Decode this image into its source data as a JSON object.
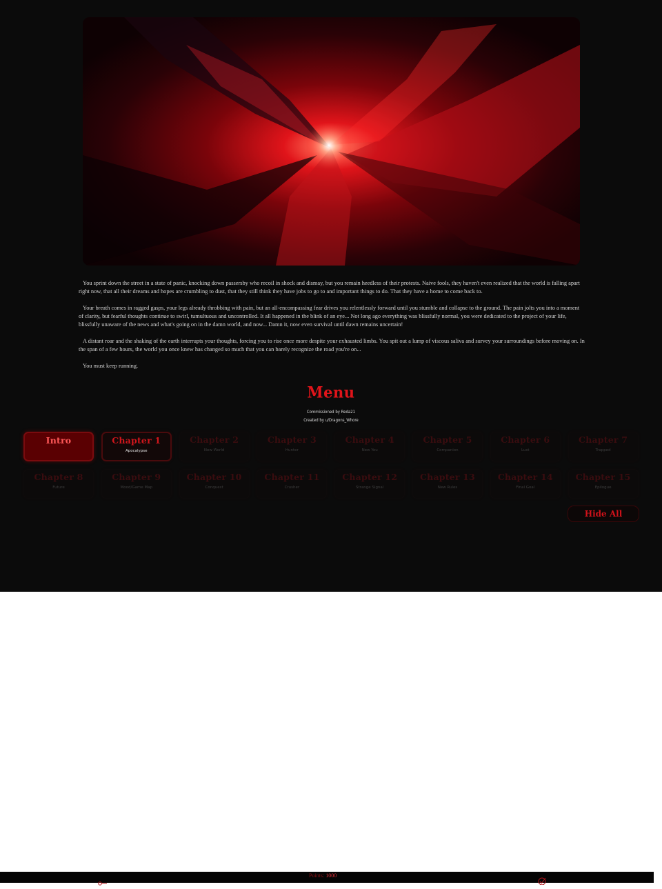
{
  "story": {
    "paragraphs": [
      "You sprint down the street in a state of panic, knocking down passersby who recoil in shock and dismay, but you remain heedless of their protests. Naive fools, they haven't even realized that the world is falling apart right now, that all their dreams and hopes are crumbling to dust, that they still think they have jobs to go to and important things to do. That they have a home to come back to.",
      "Your breath comes in ragged gasps, your legs already throbbing with pain, but an all-encompassing fear drives you relentlessly forward until you stumble and collapse to the ground. The pain jolts you into a moment of clarity, but fearful thoughts continue to swirl, tumultuous and uncontrolled. It all happened in the blink of an eye... Not long ago everything was blissfully normal, you were dedicated to the project of your life, blissfully unaware of the news and what's going on in the damn world, and now... Damn it, now even survival until dawn remains uncertain!",
      "A distant roar and the shaking of the earth interrupts your thoughts, forcing you to rise once more despite your exhausted limbs. You spit out a lump of viscous saliva and survey your surroundings before moving on. In the span of a few hours, the world you once knew has changed so much that you can barely recognize the road you're on...",
      "You must keep running."
    ]
  },
  "menu": {
    "title": "Menu",
    "commissioned": "Commissioned by Reda21",
    "created": "Created by u/Dragons_Whore",
    "hide_all": "Hide All"
  },
  "chapters": [
    {
      "title": "Intro",
      "subtitle": ""
    },
    {
      "title": "Chapter 1",
      "subtitle": "Apocalypse"
    },
    {
      "title": "Chapter 2",
      "subtitle": "New World"
    },
    {
      "title": "Chapter 3",
      "subtitle": "Hunter"
    },
    {
      "title": "Chapter 4",
      "subtitle": "New You"
    },
    {
      "title": "Chapter 5",
      "subtitle": "Companion"
    },
    {
      "title": "Chapter 6",
      "subtitle": "Lust"
    },
    {
      "title": "Chapter 7",
      "subtitle": "Trapped"
    },
    {
      "title": "Chapter 8",
      "subtitle": "Future"
    },
    {
      "title": "Chapter 9",
      "subtitle": "Mood/Game Map"
    },
    {
      "title": "Chapter 10",
      "subtitle": "Conquest"
    },
    {
      "title": "Chapter 11",
      "subtitle": "Crusher"
    },
    {
      "title": "Chapter 12",
      "subtitle": "Strange Signal"
    },
    {
      "title": "Chapter 13",
      "subtitle": "New Rules"
    },
    {
      "title": "Chapter 14",
      "subtitle": "Final Goal"
    },
    {
      "title": "Chapter 15",
      "subtitle": "Epilogue"
    }
  ],
  "footer": {
    "points_label": "Points:",
    "points_value": "1000"
  },
  "colors": {
    "accent": "#e0141a",
    "background": "#0b0b0b",
    "active_chapter": "#5a0002"
  }
}
